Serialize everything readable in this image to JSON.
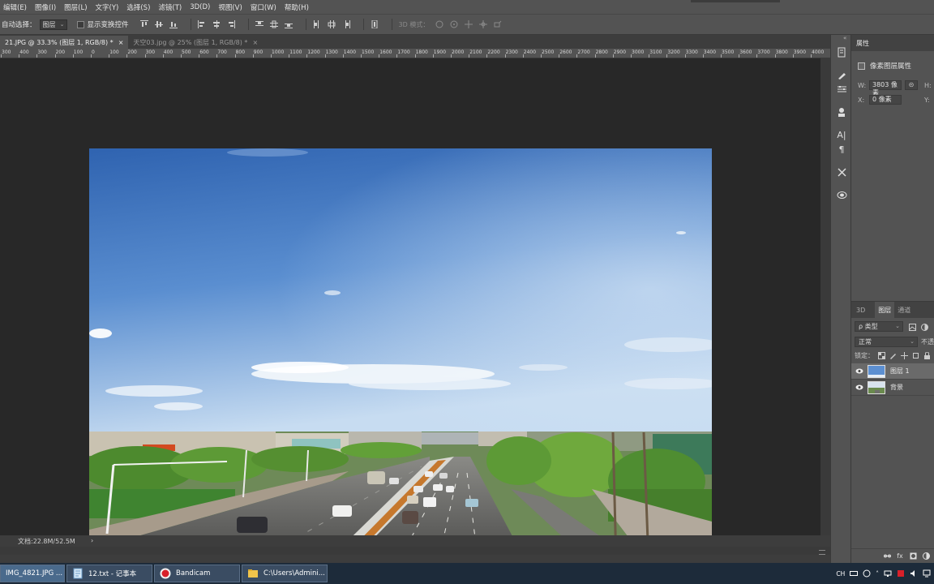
{
  "menubar": {
    "items": [
      "编辑(E)",
      "图像(I)",
      "图层(L)",
      "文字(Y)",
      "选择(S)",
      "滤镜(T)",
      "3D(D)",
      "视图(V)",
      "窗口(W)",
      "帮助(H)"
    ]
  },
  "options": {
    "auto_select_label": "自动选择：",
    "auto_select_value": "图层",
    "show_transform_label": "显示变换控件",
    "mode_3d_label": "3D 模式："
  },
  "tabs": [
    {
      "label": "21.JPG @ 33.3% (图层 1, RGB/8) *",
      "close": "×"
    },
    {
      "label": "天空03.jpg @ 25% (图层 1, RGB/8) *",
      "close": "×"
    }
  ],
  "ruler": {
    "ticks": [
      "300",
      "400",
      "300",
      "200",
      "100",
      "0",
      "100",
      "200",
      "300",
      "400",
      "500",
      "600",
      "700",
      "800",
      "900",
      "1000",
      "1100",
      "1200",
      "1300",
      "1400",
      "1500",
      "1600",
      "1700",
      "1800",
      "1900",
      "2000",
      "2100",
      "2200",
      "2300",
      "2400",
      "2500",
      "2600",
      "2700",
      "2800",
      "2900",
      "3000",
      "3100",
      "3200",
      "3300",
      "3400",
      "3500",
      "3600",
      "3700",
      "3800",
      "3900",
      "4000"
    ]
  },
  "status": {
    "doc_info": "文档:22.8M/52.5M",
    "arrow": "›"
  },
  "properties": {
    "tab_label": "属性",
    "title": "像素图层属性",
    "w_label": "W:",
    "w_value": "3803 像素",
    "h_label": "H:",
    "x_label": "X:",
    "x_value": "0 像素",
    "y_label": "Y:",
    "link_icon": "⊝"
  },
  "layers_panel": {
    "tabs": [
      "3D",
      "图层",
      "通道"
    ],
    "filter_value": "ρ 类型",
    "blend_mode": "正常",
    "opacity_label": "不透",
    "lock_label": "锁定：",
    "layers": [
      {
        "name": "图层 1",
        "selected": true
      },
      {
        "name": "背景",
        "selected": false
      }
    ],
    "bottom_fx": "fx"
  },
  "taskbar": {
    "items": [
      {
        "label": "IMG_4821.JPG ...",
        "icon": "photoshop-icon"
      },
      {
        "label": "12.txt - 记事本",
        "icon": "notepad-icon"
      },
      {
        "label": "Bandicam",
        "icon": "bandicam-icon"
      },
      {
        "label": "C:\\Users\\Admini...",
        "icon": "folder-icon"
      }
    ],
    "tray_lang": "CH"
  },
  "colors": {
    "ps_panel": "#535353",
    "ps_dark": "#282828",
    "sky_top": "#3c6fb9",
    "sky_bottom": "#b9d3ef",
    "taskbar": "#1d2b3a"
  }
}
